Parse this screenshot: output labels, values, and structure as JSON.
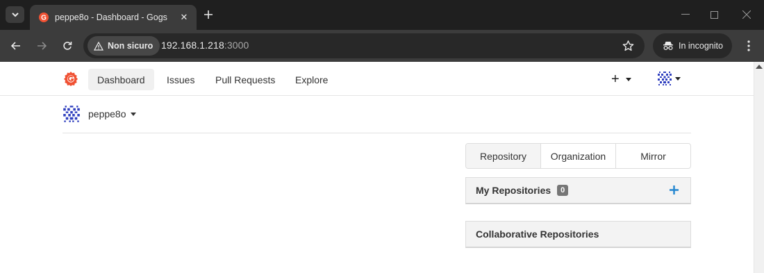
{
  "browser": {
    "tab_title": "peppe8o - Dashboard - Gogs",
    "security_label": "Non sicuro",
    "url_host": "192.168.1.218",
    "url_port": ":3000",
    "incognito_label": "In incognito"
  },
  "header": {
    "nav": [
      "Dashboard",
      "Issues",
      "Pull Requests",
      "Explore"
    ],
    "active_nav": "Dashboard",
    "create_symbol": "+"
  },
  "context": {
    "username": "peppe8o"
  },
  "repo_tabs": [
    "Repository",
    "Organization",
    "Mirror"
  ],
  "panels": {
    "my_repositories": {
      "title": "My Repositories",
      "count": "0"
    },
    "collaborative_repositories": {
      "title": "Collaborative Repositories"
    }
  },
  "colors": {
    "browser_frame": "#1f1f1f",
    "browser_toolbar": "#3c3c3c",
    "gogs_logo": "#f05133",
    "accent_blue": "#2185d0",
    "identicon": "#2f3fbf"
  }
}
